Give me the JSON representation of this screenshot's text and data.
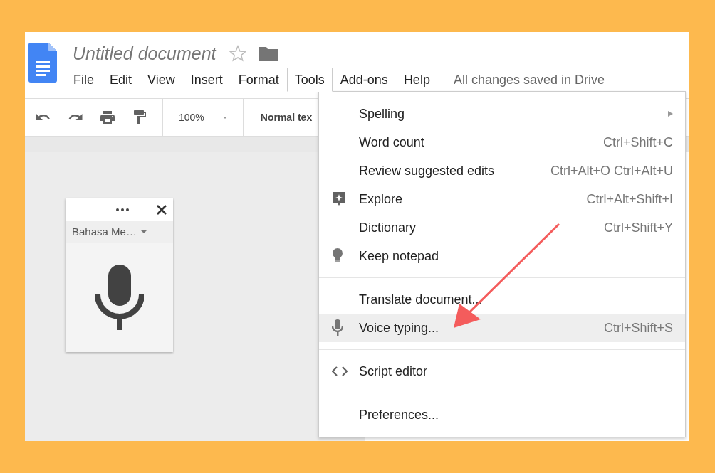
{
  "document": {
    "title": "Untitled document",
    "starred": false,
    "save_status": "All changes saved in Drive"
  },
  "menubar": [
    {
      "label": "File",
      "selected": false
    },
    {
      "label": "Edit",
      "selected": false
    },
    {
      "label": "View",
      "selected": false
    },
    {
      "label": "Insert",
      "selected": false
    },
    {
      "label": "Format",
      "selected": false
    },
    {
      "label": "Tools",
      "selected": true
    },
    {
      "label": "Add-ons",
      "selected": false
    },
    {
      "label": "Help",
      "selected": false
    }
  ],
  "toolbar": {
    "zoom": "100%",
    "style": "Normal tex"
  },
  "voice_widget": {
    "language": "Bahasa Me…"
  },
  "tools_menu": [
    {
      "kind": "submenu",
      "label": "Spelling",
      "selected": false,
      "separator_before": false
    },
    {
      "kind": "plain",
      "label": "Word count",
      "shortcut": "Ctrl+Shift+C",
      "selected": false,
      "separator_before": false
    },
    {
      "kind": "plain",
      "label": "Review suggested edits",
      "shortcut": "Ctrl+Alt+O Ctrl+Alt+U",
      "selected": false,
      "separator_before": false
    },
    {
      "kind": "explore",
      "label": "Explore",
      "shortcut": "Ctrl+Alt+Shift+I",
      "selected": false,
      "separator_before": false
    },
    {
      "kind": "plain",
      "label": "Dictionary",
      "shortcut": "Ctrl+Shift+Y",
      "selected": false,
      "separator_before": false
    },
    {
      "kind": "bulb",
      "label": "Keep notepad",
      "selected": false,
      "separator_before": false
    },
    {
      "kind": "plain",
      "label": "Translate document...",
      "selected": false,
      "separator_before": true
    },
    {
      "kind": "mic",
      "label": "Voice typing...",
      "shortcut": "Ctrl+Shift+S",
      "selected": true,
      "separator_before": false
    },
    {
      "kind": "code",
      "label": "Script editor",
      "selected": false,
      "separator_before": true
    },
    {
      "kind": "plain",
      "label": "Preferences...",
      "selected": false,
      "separator_before": true
    }
  ]
}
